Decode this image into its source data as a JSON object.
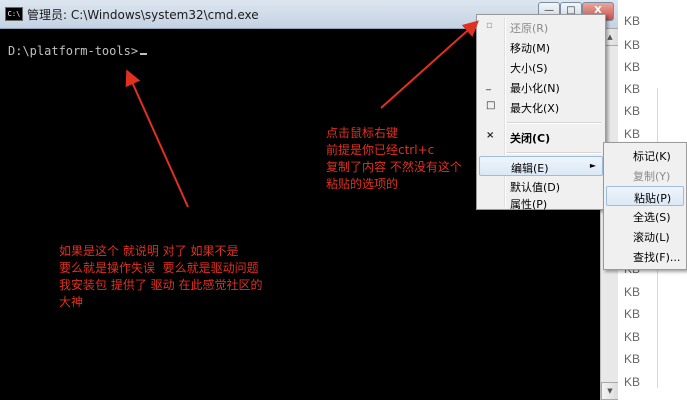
{
  "window": {
    "title": "管理员: C:\\Windows\\system32\\cmd.exe",
    "icon_glyph": "C:\\",
    "buttons": {
      "minimize": "—",
      "maximize": "□",
      "close": "X"
    }
  },
  "console": {
    "prompt": "D:\\platform-tools>"
  },
  "background": {
    "size_units": [
      "KB",
      "KB",
      "KB",
      "KB",
      "KB",
      "KB",
      "KB",
      "KB",
      "KB",
      "KB",
      "KB",
      "KB",
      "KB",
      "KB",
      "KB",
      "KB",
      "KB",
      "KB"
    ]
  },
  "context_menu": {
    "items": [
      {
        "label": "还原(R)",
        "icon": "▫",
        "disabled": true
      },
      {
        "label": "移动(M)",
        "icon": "",
        "disabled": false
      },
      {
        "label": "大小(S)",
        "icon": "",
        "disabled": false
      },
      {
        "label": "最小化(N)",
        "icon": "_",
        "disabled": false
      },
      {
        "label": "最大化(X)",
        "icon": "□",
        "disabled": false
      },
      {
        "label": "关闭(C)",
        "icon": "×",
        "disabled": false,
        "bold": true
      },
      {
        "label": "编辑(E)",
        "icon": "",
        "disabled": false,
        "submenu": "►",
        "highlighted": true
      },
      {
        "label": "默认值(D)",
        "icon": "",
        "disabled": false
      },
      {
        "label": "属性(P)",
        "icon": "",
        "disabled": false
      }
    ]
  },
  "edit_submenu": {
    "items": [
      {
        "label": "标记(K)",
        "disabled": false
      },
      {
        "label": "复制(Y)",
        "disabled": true
      },
      {
        "label": "粘贴(P)",
        "disabled": false,
        "highlighted": true
      },
      {
        "label": "全选(S)",
        "disabled": false
      },
      {
        "label": "滚动(L)",
        "disabled": false
      },
      {
        "label": "查找(F)...",
        "disabled": false
      }
    ]
  },
  "annotations": {
    "right": "点击鼠标右键\n前提是你已经ctrl+c\n复制了内容 不然没有这个\n粘贴的选项的",
    "left": "如果是这个 就说明 对了 如果不是\n要么就是操作失误  要么就是驱动问题\n我安装包 提供了 驱动 在此感觉社区的\n大神",
    "color": "#e03020"
  }
}
